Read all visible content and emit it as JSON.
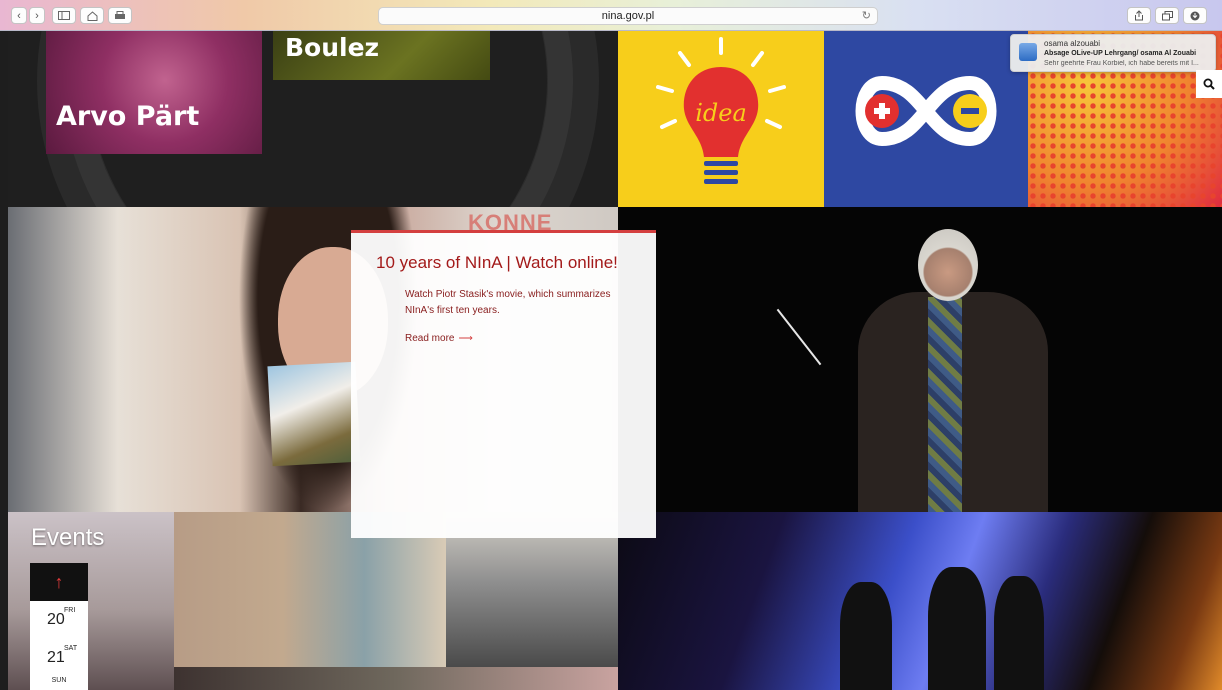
{
  "browser": {
    "url": "nina.gov.pl",
    "back_icon": "chevron-left-icon",
    "forward_icon": "chevron-right-icon",
    "reload_icon": "reload-icon"
  },
  "tiles": {
    "arvo": "Arvo Pärt",
    "boulez": "Boulez",
    "idea_word": "idea",
    "konn": "KONNE"
  },
  "card": {
    "title": "10 years of NInA | Watch online!",
    "body": "Watch Piotr Stasik's movie, which summarizes NInA's first ten years.",
    "link": "Read more",
    "arrow": "⟶"
  },
  "events": {
    "title": "Events",
    "up_arrow": "↑",
    "days": [
      {
        "num": "20",
        "weekday": "FRI"
      },
      {
        "num": "21",
        "weekday": "SAT"
      }
    ],
    "next_weekday": "SUN"
  },
  "notification": {
    "from": "osama alzouabi",
    "subject": "Absage OLive-UP Lehrgang/ osama Al Zouabi",
    "preview": "Sehr geehrte Frau Korbiel, ich habe bereits mit I..."
  },
  "colors": {
    "accent": "#d43f3f",
    "idea_bg": "#f7ce1b",
    "infinity_bg": "#2e48a2"
  }
}
